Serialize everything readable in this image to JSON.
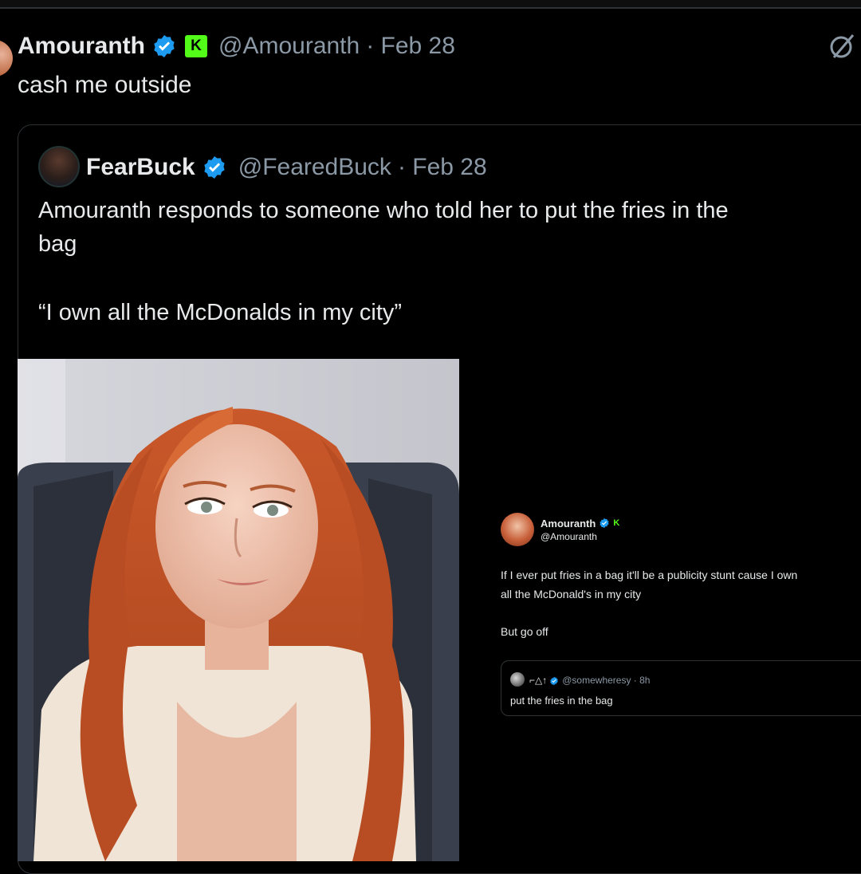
{
  "tweet": {
    "author_name": "Amouranth",
    "handle": "@Amouranth",
    "date": "· Feb 28",
    "text": "cash me outside",
    "kick_badge": "K",
    "grok_icon": "grok-slash-icon"
  },
  "quoted_tweet": {
    "author_name": "FearBuck",
    "handle": "@FearedBuck",
    "date": "· Feb 28",
    "text_line1": "Amouranth responds to someone who told her to put the fries in the",
    "text_line2": "bag",
    "quote_line": "“I own all the McDonalds in my city”"
  },
  "embedded_screenshot": {
    "author_name": "Amouranth",
    "handle": "@Amouranth",
    "kick_badge": "K",
    "text_line1": "If I ever put fries in a bag it'll be a publicity stunt cause I own",
    "text_line2": "all the McDonald's in my city",
    "text_line3": "But go off",
    "reply": {
      "name_glyphs": "⌐△↑",
      "handle_time": "@somewheresy · 8h",
      "text": "put the fries in the bag"
    }
  },
  "colors": {
    "background": "#000000",
    "text": "#e7e9ea",
    "muted": "#8b98a5",
    "verified": "#1d9bf0",
    "kick": "#53fc18",
    "border": "#2f3336"
  }
}
